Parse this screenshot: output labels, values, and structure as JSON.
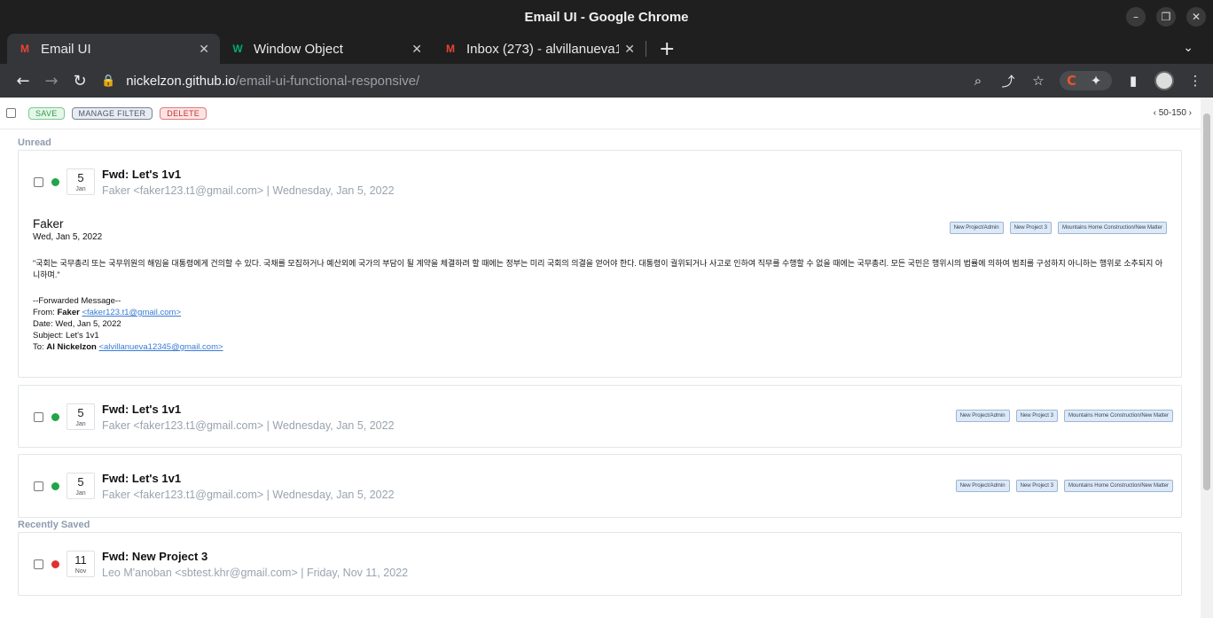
{
  "window": {
    "title": "Email UI - Google Chrome"
  },
  "tabs": [
    {
      "label": "Email UI",
      "favicon": "gmail-icon"
    },
    {
      "label": "Window Object",
      "favicon": "w3-icon"
    },
    {
      "label": "Inbox (273) - alvillanueva1",
      "favicon": "gmail-icon"
    }
  ],
  "address": {
    "host": "nickelzon.github.io",
    "path": "/email-ui-functional-responsive/"
  },
  "actions": {
    "save": "SAVE",
    "manage": "MANAGE FILTER",
    "delete": "DELETE",
    "pager": "‹ 50-150 ›"
  },
  "sections": {
    "unread": "Unread",
    "saved": "Recently Saved"
  },
  "tags": [
    "New Project/Admin",
    "New Project 3",
    "Mountains Home Construction/New Matter"
  ],
  "emails": [
    {
      "day": "5",
      "month": "Jan",
      "subject": "Fwd: Let's 1v1",
      "from": "Faker <faker123.t1@gmail.com> | Wednesday, Jan 5, 2022",
      "status_color": "#22a447"
    },
    {
      "day": "5",
      "month": "Jan",
      "subject": "Fwd: Let's 1v1",
      "from": "Faker <faker123.t1@gmail.com> | Wednesday, Jan 5, 2022",
      "status_color": "#22a447"
    },
    {
      "day": "5",
      "month": "Jan",
      "subject": "Fwd: Let's 1v1",
      "from": "Faker <faker123.t1@gmail.com> | Wednesday, Jan 5, 2022",
      "status_color": "#22a447"
    },
    {
      "day": "11",
      "month": "Nov",
      "subject": "Fwd: New Project 3",
      "from": "Leo M'anoban <sbtest.khr@gmail.com> | Friday, Nov 11, 2022",
      "status_color": "#e03131"
    }
  ],
  "expanded": {
    "sender": "Faker",
    "date": "Wed, Jan 5, 2022",
    "message": "\"국회는 국무총리 또는 국무위원의 해임을 대통령에게 건의할 수 있다. 국채를 모집하거나 예산외에 국가의 부담이 될 계약을 체결하려 할 때에는 정부는 미리 국회의 의결을 얻어야 한다. 대통령이 궐위되거나 사고로 인하여 직무를 수행할 수 없을 때에는 국무총리. 모든 국민은 행위시의 법률에 의하여 범죄를 구성하지 아니하는 행위로 소추되지 아니하며.\"",
    "fwd_header": "--Forwarded Message--",
    "from_label": "From:",
    "from_name": "Faker",
    "from_email": "<faker123.t1@gmail.com>",
    "date_line": "Date: Wed, Jan 5, 2022",
    "subject_line": "Subject: Let's 1v1",
    "to_label": "To:",
    "to_name": "Al Nickelzon",
    "to_email": "<alvillanueva12345@gmail.com>"
  }
}
